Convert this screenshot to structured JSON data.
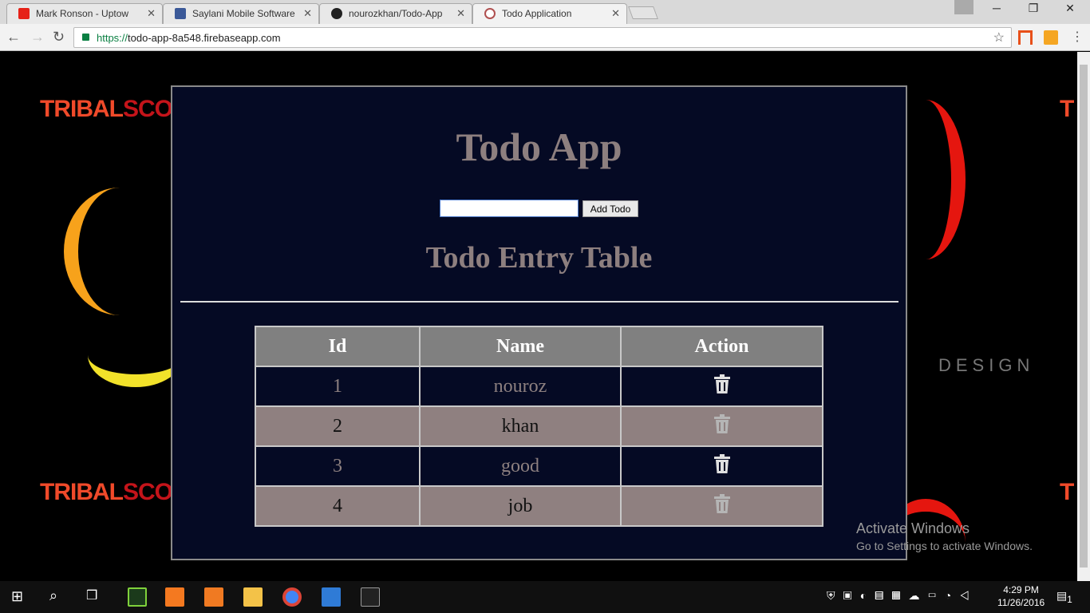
{
  "browser": {
    "tabs": [
      {
        "title": "Mark Ronson - Uptow",
        "icon": "youtube-icon",
        "color": "#e62117"
      },
      {
        "title": "Saylani Mobile Software",
        "icon": "facebook-icon",
        "color": "#3b5998"
      },
      {
        "title": "nourozkhan/Todo-App",
        "icon": "github-icon",
        "color": "#222222"
      },
      {
        "title": "Todo Application",
        "icon": "app-icon",
        "color": "#b05050"
      }
    ],
    "url_scheme": "https://",
    "url_rest": "todo-app-8a548.firebaseapp.com"
  },
  "background": {
    "brand_a": "TRIBAL",
    "brand_b": "SCOR",
    "side_text": "DESIGN"
  },
  "app": {
    "title": "Todo App",
    "input_value": "",
    "add_label": "Add Todo",
    "table_title": "Todo Entry Table",
    "columns": [
      "Id",
      "Name",
      "Action"
    ],
    "rows": [
      {
        "id": "1",
        "name": "nouroz"
      },
      {
        "id": "2",
        "name": "khan"
      },
      {
        "id": "3",
        "name": "good"
      },
      {
        "id": "4",
        "name": "job"
      }
    ]
  },
  "watermark": {
    "line1": "Activate Windows",
    "line2": "Go to Settings to activate Windows."
  },
  "taskbar": {
    "time": "4:29 PM",
    "date": "11/26/2016",
    "notifications": "1"
  }
}
